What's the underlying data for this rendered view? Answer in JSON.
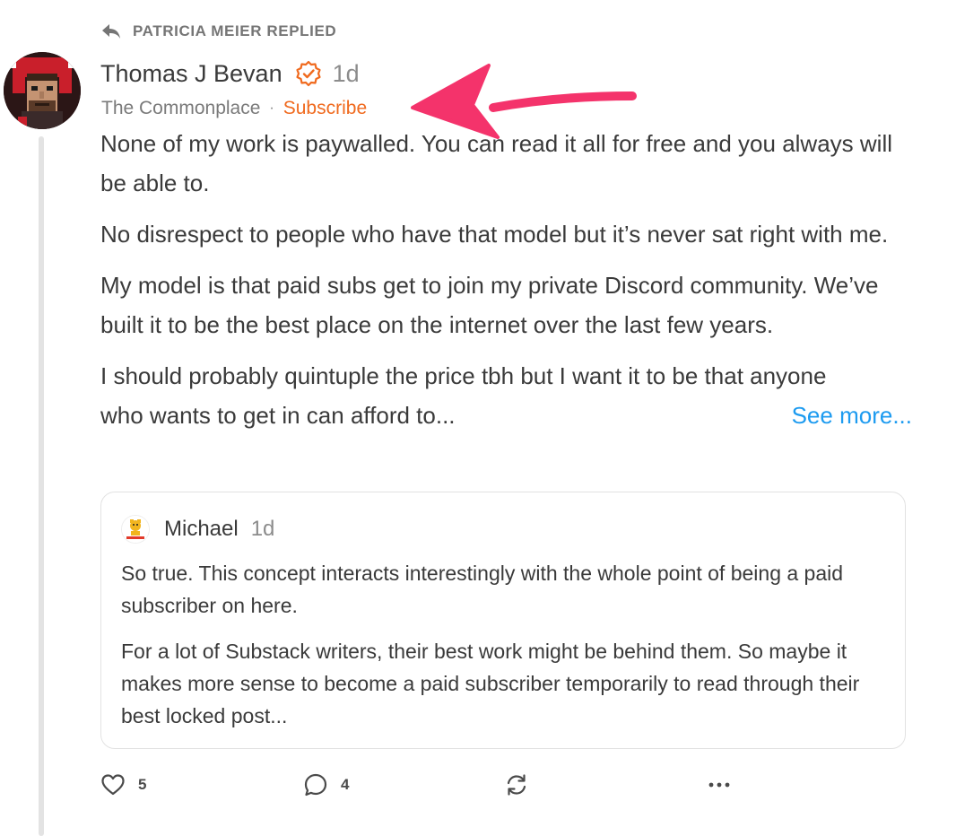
{
  "reply_header": {
    "text": "PATRICIA MEIER REPLIED",
    "icon": "reply-icon"
  },
  "comment": {
    "author": "Thomas J Bevan",
    "verified_icon": "verified-check-icon",
    "time": "1d",
    "publication": "The Commonplace",
    "separator": "·",
    "subscribe_label": "Subscribe",
    "paragraphs": [
      "None of my work is paywalled. You can read it all for free and you always will be able to.",
      "No disrespect to people who have that model but it’s never sat right with me.",
      "My model is that paid subs get to join my private Discord community. We’ve built it to be the best place on the internet over the last few years."
    ],
    "last_paragraph_line1": "I should probably quintuple the price tbh but I want it to be that anyone",
    "last_paragraph_line2": "who wants to get in can afford to...",
    "see_more_label": "See more..."
  },
  "quoted": {
    "author": "Michael",
    "time": "1d",
    "paragraphs": [
      "So true. This concept interacts interestingly with the whole point of being a paid subscriber on here.",
      "For a lot of Substack writers, their best work might be behind them. So maybe it makes more sense to become a paid subscriber temporarily to read through their best locked post..."
    ]
  },
  "actions": {
    "like_count": "5",
    "comment_count": "4",
    "like_icon": "heart-icon",
    "comment_icon": "comment-bubble-icon",
    "restack_icon": "restack-icon",
    "more_icon": "more-dots-icon"
  },
  "colors": {
    "accent_orange": "#f06a1e",
    "link_blue": "#1d9bf0",
    "arrow_pink": "#f4336b",
    "text": "#3a3a3a",
    "muted": "#757575"
  }
}
